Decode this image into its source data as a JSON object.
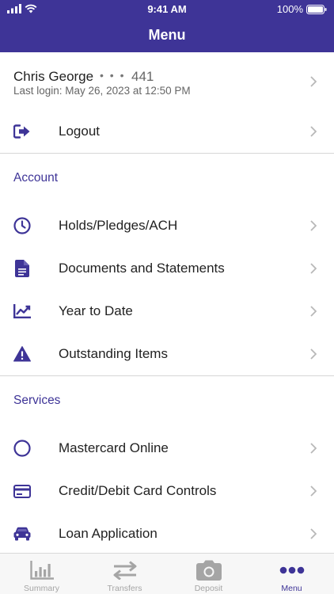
{
  "status_bar": {
    "time": "9:41 AM",
    "battery": "100%"
  },
  "header": {
    "title": "Menu"
  },
  "profile": {
    "name": "Chris George",
    "masked": "• • •",
    "account_last_digits": "441",
    "last_login": "Last login: May 26, 2023 at 12:50 PM"
  },
  "logout": {
    "label": "Logout"
  },
  "account_section": {
    "title": "Account",
    "items": [
      {
        "label": "Holds/Pledges/ACH",
        "icon": "clock-icon"
      },
      {
        "label": "Documents and Statements",
        "icon": "document-icon"
      },
      {
        "label": "Year to Date",
        "icon": "chart-icon"
      },
      {
        "label": "Outstanding Items",
        "icon": "warning-icon"
      }
    ]
  },
  "services_section": {
    "title": "Services",
    "items": [
      {
        "label": "Mastercard Online",
        "icon": "circle-icon"
      },
      {
        "label": "Credit/Debit Card Controls",
        "icon": "credit-card-icon"
      },
      {
        "label": "Loan Application",
        "icon": "car-icon"
      }
    ]
  },
  "tabbar": {
    "tabs": [
      {
        "label": "Summary",
        "icon": "bar-chart-icon",
        "active": false
      },
      {
        "label": "Transfers",
        "icon": "transfer-arrows-icon",
        "active": false
      },
      {
        "label": "Deposit",
        "icon": "camera-icon",
        "active": false
      },
      {
        "label": "Menu",
        "icon": "more-dots-icon",
        "active": true
      }
    ]
  },
  "colors": {
    "brand": "#3e3497",
    "divider": "#d6d6d6",
    "chevron": "#b8b8b8",
    "tab_inactive": "#a5a5a5"
  }
}
